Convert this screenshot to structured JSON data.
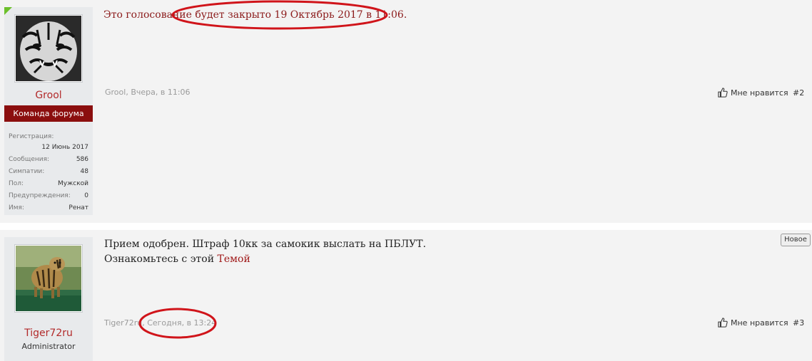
{
  "posts": [
    {
      "author": "Grool",
      "user_title": "Команда форума",
      "stats": [
        {
          "label": "Регистрация:",
          "value": "12 Июнь 2017"
        },
        {
          "label": "Сообщения:",
          "value": "586"
        },
        {
          "label": "Симпатии:",
          "value": "48"
        },
        {
          "label": "Пол:",
          "value": "Мужской"
        },
        {
          "label": "Предупреждения:",
          "value": "0"
        },
        {
          "label": "Имя:",
          "value": "Ренат"
        }
      ],
      "message": "Это голосование будет закрыто 19 Октябрь 2017 в 11:06.",
      "meta": "Grool, Вчера, в 11:06",
      "like_label": "Мне нравится",
      "permalink": "#2"
    },
    {
      "author": "Tiger72ru",
      "user_title": "Administrator",
      "message_line1": "Прием одобрен. Штраф 10кк за самокик выслать на ПБЛУТ.",
      "message_line2_prefix": "Ознакомьтесь с этой ",
      "message_link": "Темой",
      "meta_author": "Tiger72ru",
      "meta_sep": ", ",
      "meta_time": "Сегодня, в 13:24",
      "like_label": "Мне нравится",
      "permalink": "#3",
      "new_badge": "Новое"
    }
  ],
  "icons": {
    "like": "thumbs-up-icon"
  },
  "colors": {
    "username": "#b22a2a",
    "user_title_bg": "#8b0e0e",
    "annotation": "#d0141a",
    "online_corner": "#6cc02b"
  }
}
